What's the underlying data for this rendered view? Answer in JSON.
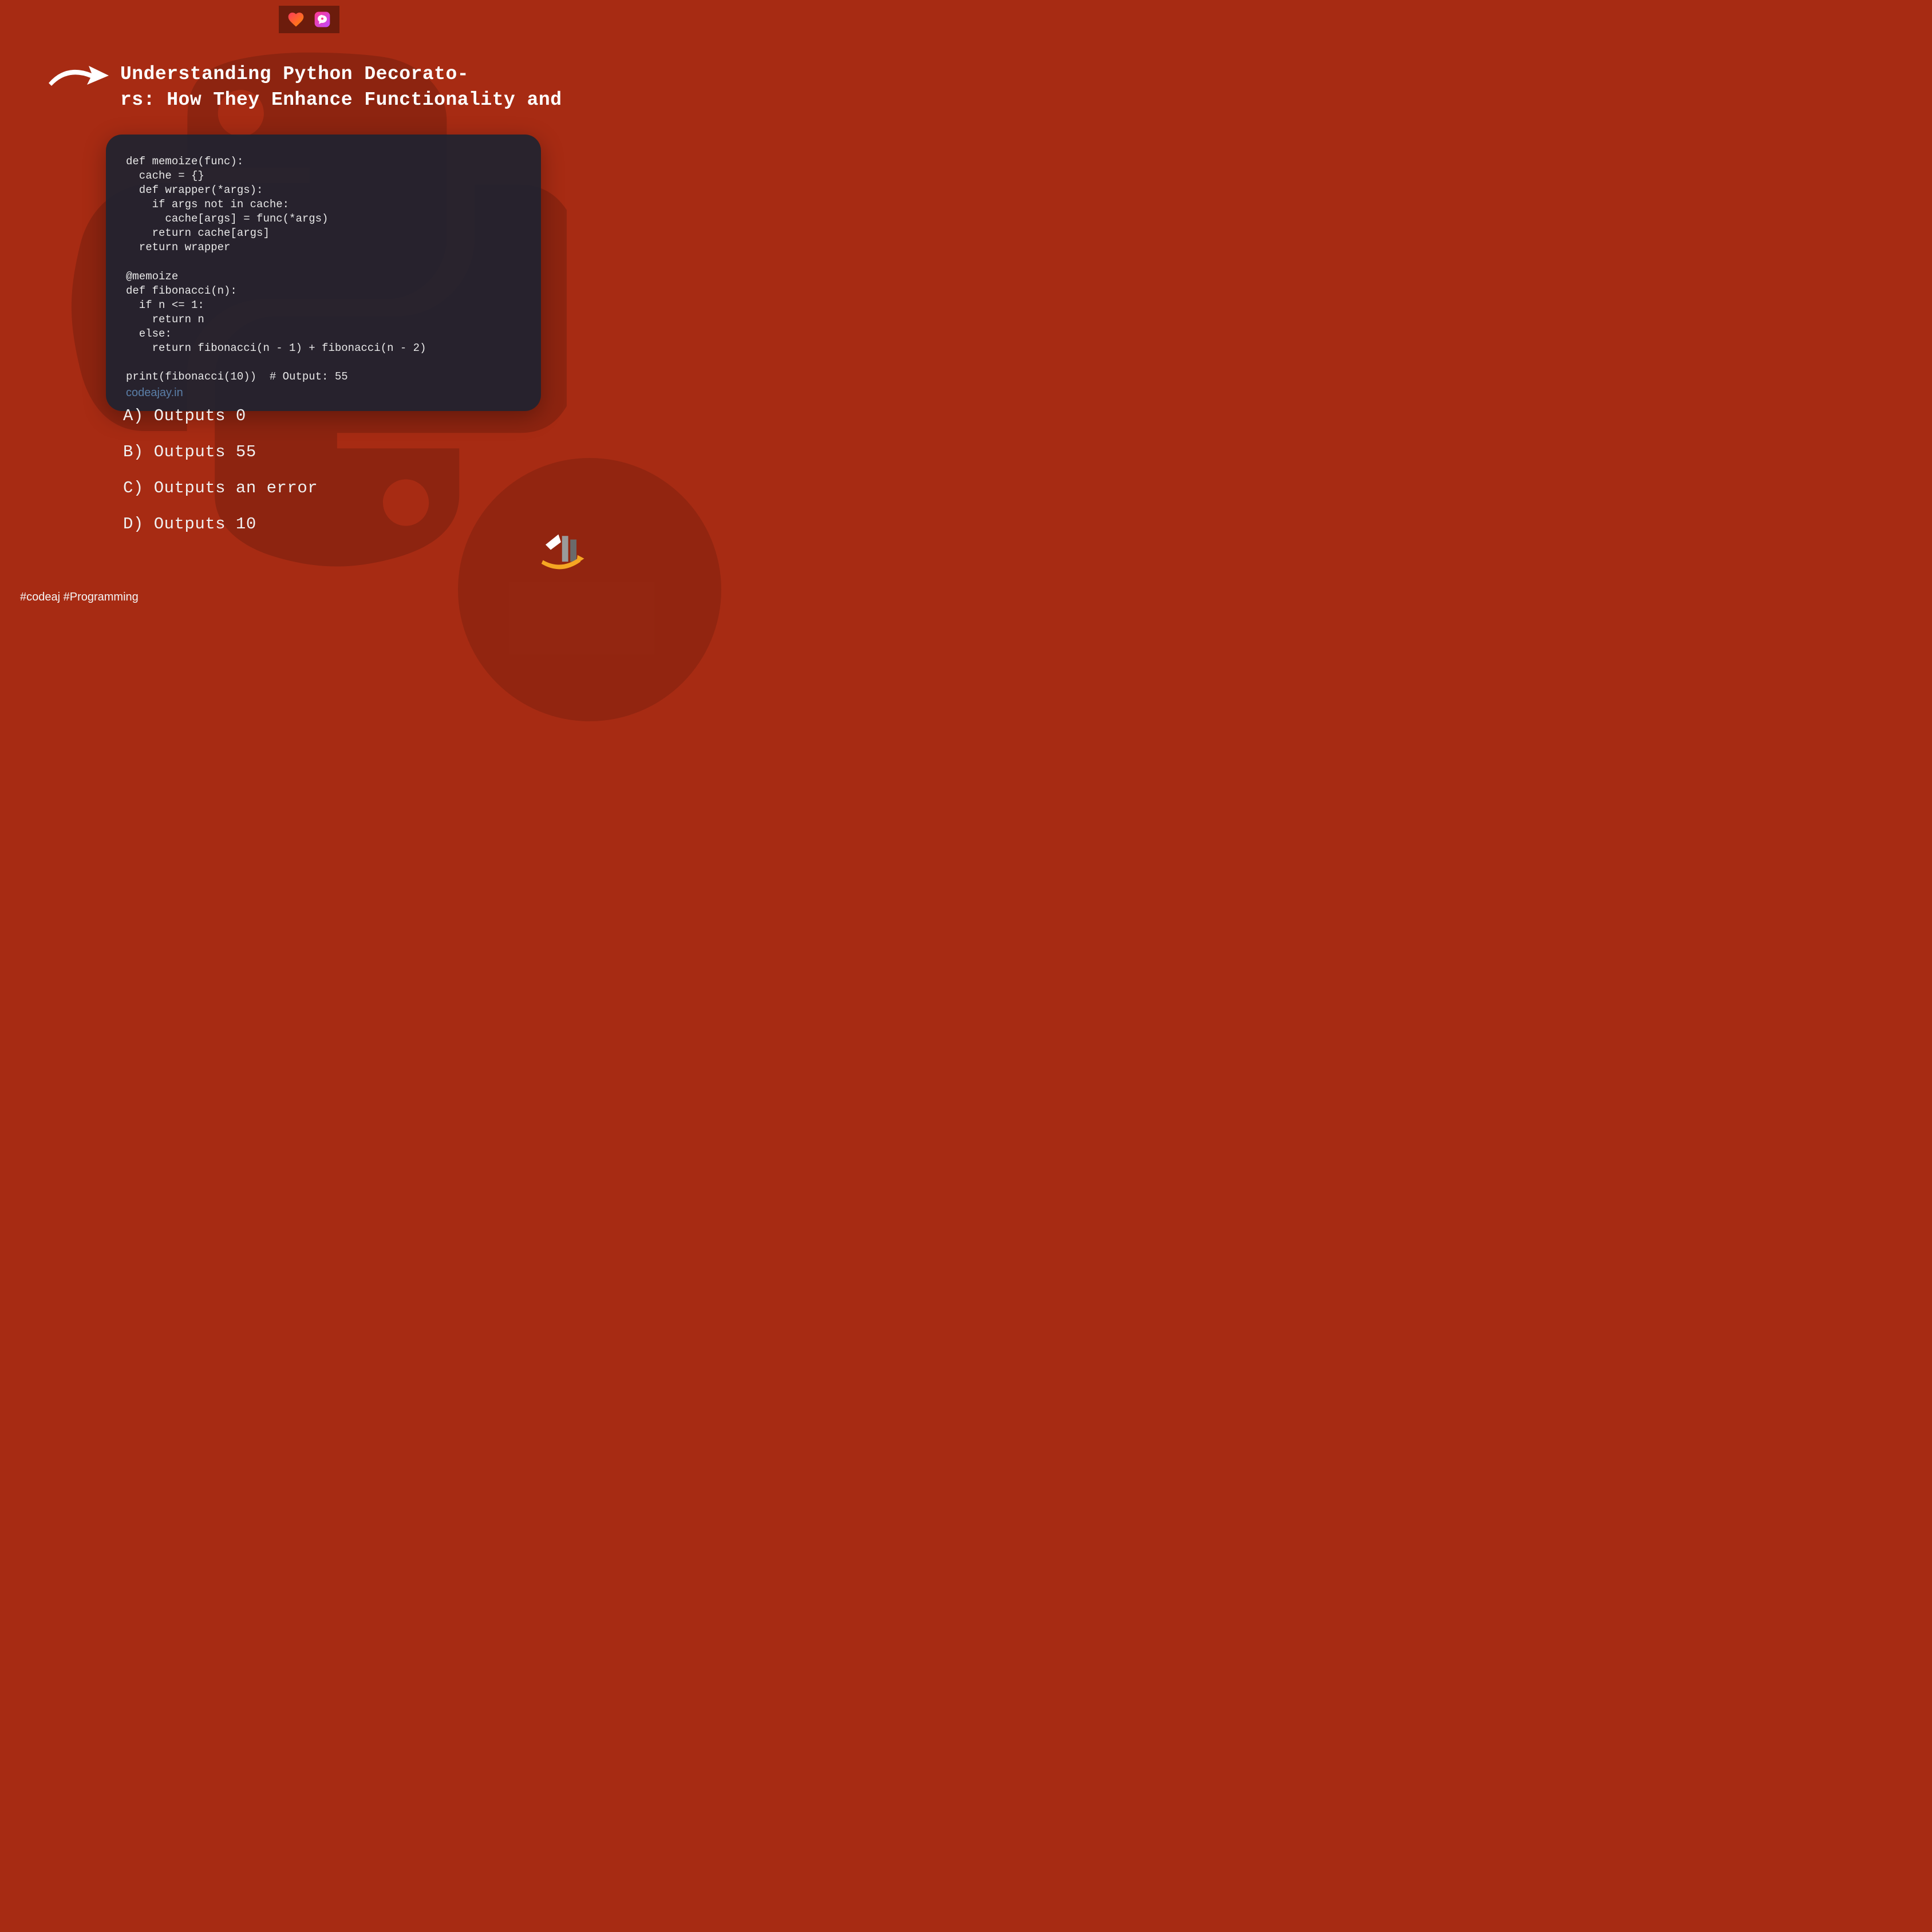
{
  "title": "Understanding Python Decorato-\nrs: How They Enhance Functionality and",
  "code": "def memoize(func):\n  cache = {}\n  def wrapper(*args):\n    if args not in cache:\n      cache[args] = func(*args)\n    return cache[args]\n  return wrapper\n\n@memoize\ndef fibonacci(n):\n  if n <= 1:\n    return n\n  else:\n    return fibonacci(n - 1) + fibonacci(n - 2)\n\nprint(fibonacci(10))  # Output: 55",
  "watermark": "codeajay.in",
  "options": {
    "a": "A) Outputs 0",
    "b": "B) Outputs 55",
    "c": "C) Outputs an error",
    "d": "D) Outputs 10"
  },
  "hashtags": "#codeaj #Programming",
  "icons": {
    "heart": "heart-icon",
    "comment": "comment-icon",
    "arrow": "arrow-right-icon",
    "logo": "brand-logo"
  }
}
